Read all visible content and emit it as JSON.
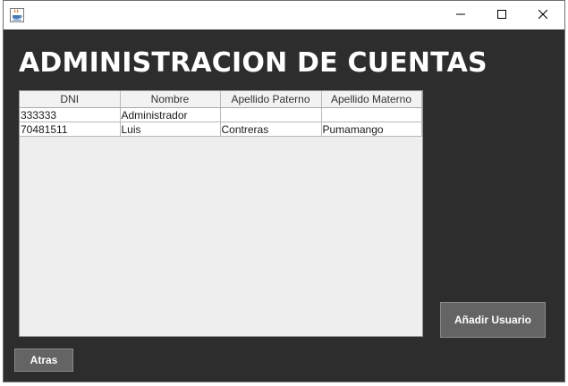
{
  "window": {
    "app_icon": "java-cup-icon",
    "minimize_icon": "minimize-icon",
    "maximize_icon": "maximize-icon",
    "close_icon": "close-icon"
  },
  "page": {
    "title": "ADMINISTRACION DE CUENTAS"
  },
  "table": {
    "headers": [
      "DNI",
      "Nombre",
      "Apellido Paterno",
      "Apellido Materno"
    ],
    "rows": [
      [
        "333333",
        "Administrador",
        "",
        ""
      ],
      [
        "70481511",
        "Luis",
        "Contreras",
        "Pumamango"
      ]
    ]
  },
  "buttons": {
    "add_user": "Añadir Usuario",
    "back": "Atras"
  }
}
